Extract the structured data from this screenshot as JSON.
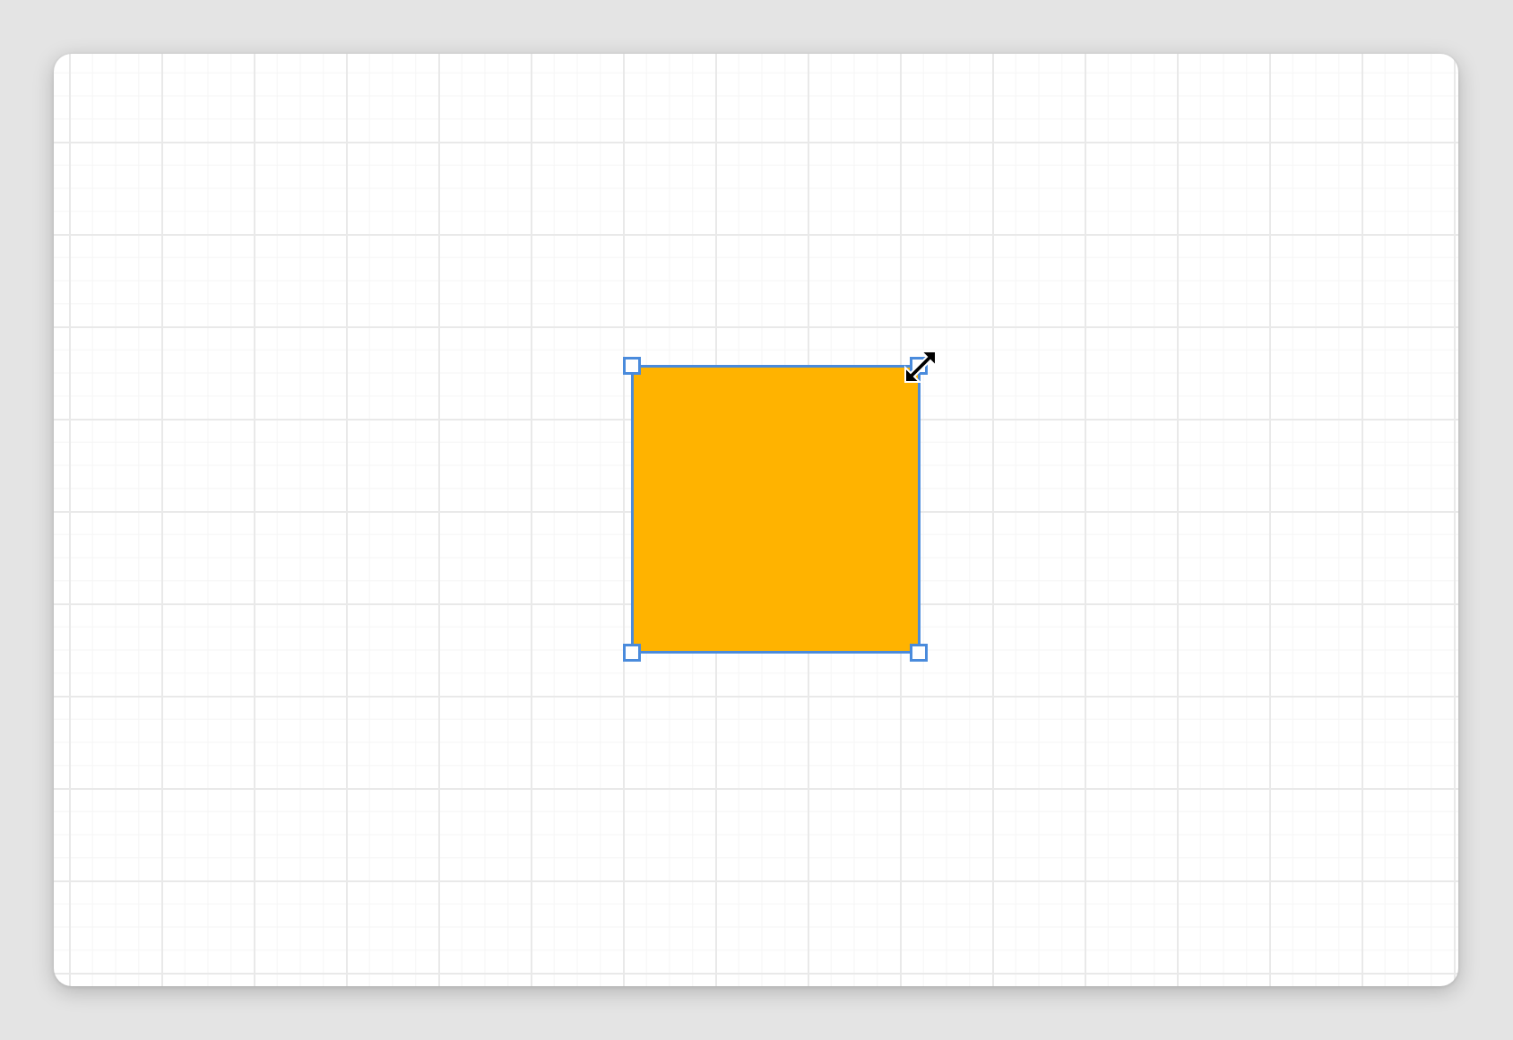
{
  "canvas": {
    "background": "#ffffff",
    "grid_color": "#e9e9e9"
  },
  "shape": {
    "kind": "rectangle",
    "fill": "#ffb300",
    "selected": true,
    "selection_color": "#4a8bdc"
  },
  "cursor": {
    "icon": "resize-diagonal-icon"
  }
}
